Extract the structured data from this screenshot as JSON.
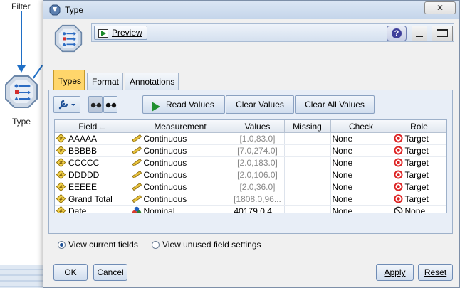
{
  "background": {
    "filter_label": "Filter",
    "type_node_label": "Type"
  },
  "window": {
    "title": "Type",
    "preview_label": "Preview",
    "help_label": "?"
  },
  "tabs": [
    {
      "label": "Types",
      "active": true
    },
    {
      "label": "Format",
      "active": false
    },
    {
      "label": "Annotations",
      "active": false
    }
  ],
  "toolbar": {
    "read_values_label": "Read Values",
    "clear_values_label": "Clear Values",
    "clear_all_values_label": "Clear All Values"
  },
  "table": {
    "columns": [
      "Field",
      "Measurement",
      "Values",
      "Missing",
      "Check",
      "Role"
    ],
    "rows": [
      {
        "field": "AAAAA",
        "measurement": "Continuous",
        "values": "[1.0,83.0]",
        "missing": "",
        "check": "None",
        "role": "Target"
      },
      {
        "field": "BBBBB",
        "measurement": "Continuous",
        "values": "[7.0,274.0]",
        "missing": "",
        "check": "None",
        "role": "Target"
      },
      {
        "field": "CCCCC",
        "measurement": "Continuous",
        "values": "[2.0,183.0]",
        "missing": "",
        "check": "None",
        "role": "Target"
      },
      {
        "field": "DDDDD",
        "measurement": "Continuous",
        "values": "[2.0,106.0]",
        "missing": "",
        "check": "None",
        "role": "Target"
      },
      {
        "field": "EEEEE",
        "measurement": "Continuous",
        "values": "[2.0,36.0]",
        "missing": "",
        "check": "None",
        "role": "Target"
      },
      {
        "field": "Grand Total",
        "measurement": "Continuous",
        "values": "[1808.0,96...",
        "missing": "",
        "check": "None",
        "role": "Target"
      },
      {
        "field": "Date",
        "measurement": "Nominal",
        "values": "40179.0,4...",
        "missing": "",
        "check": "None",
        "role": "None"
      }
    ]
  },
  "view_options": {
    "current_label": "View current fields",
    "unused_label": "View unused field settings",
    "selected": "current"
  },
  "footer": {
    "ok_label": "OK",
    "cancel_label": "Cancel",
    "apply_label": "Apply",
    "reset_label": "Reset"
  }
}
